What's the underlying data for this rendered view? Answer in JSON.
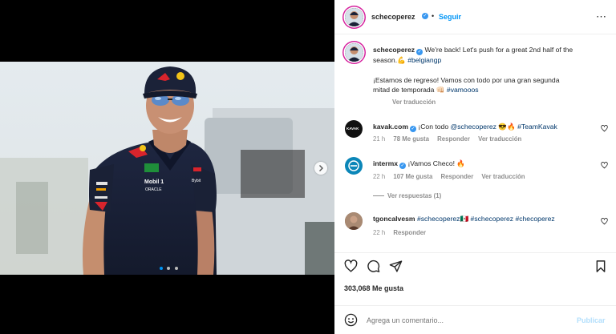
{
  "header": {
    "username": "schecoperez",
    "dot": "•",
    "follow": "Seguir",
    "more": "⋯"
  },
  "caption": {
    "username": "schecoperez",
    "text_en_1": "We're back! Let's push for a great 2nd half of the",
    "text_en_2": "season.",
    "emoji_en": "💪",
    "hashtag": "#belgiangp",
    "text_es_1": "¡Estamos de regreso! Vamos con todo por una gran segunda",
    "text_es_2": "mitad de temporada",
    "emoji_es": "👊🏻",
    "hashtag_es": "#vamooos",
    "translate": "Ver traducción"
  },
  "comments": [
    {
      "username": "kavak.com",
      "avatar_text": "KAVAK",
      "text_pre": "¡Con todo ",
      "mention": "@schecoperez",
      "emoji": "😎🔥",
      "hashtag": "#TeamKavak",
      "time": "21 h",
      "likes": "78 Me gusta",
      "reply": "Responder",
      "translate": "Ver traducción"
    },
    {
      "username": "intermx",
      "text": "¡Vamos Checo!",
      "emoji": "🔥",
      "time": "22 h",
      "likes": "107 Me gusta",
      "reply": "Responder",
      "translate": "Ver traducción",
      "view_replies": "Ver respuestas (1)"
    },
    {
      "username": "tgoncalvesm",
      "mention": "#schecoperez",
      "flag": "🇲🇽",
      "hashtag1": "#schecoperez",
      "hashtag2": "#checoperez",
      "time": "22 h",
      "reply": "Responder"
    }
  ],
  "actions": {
    "likes": "303,068 Me gusta"
  },
  "composer": {
    "placeholder": "Agrega un comentario...",
    "post": "Publicar"
  },
  "shirt": {
    "tag": "TAG HEUER",
    "mobil": "Mobil 1",
    "oracle": "ORACLE",
    "bybit": "Bybit"
  },
  "colors": {
    "accent": "#0095f6",
    "navy": "#1b2238",
    "verified": "#3897f0"
  }
}
